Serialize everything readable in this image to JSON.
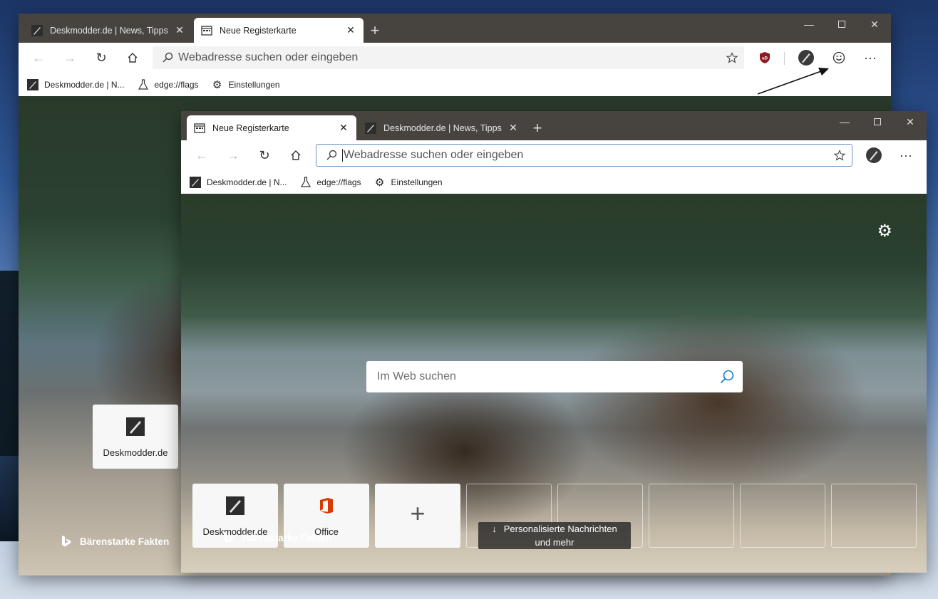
{
  "back_window": {
    "tabs": [
      {
        "label": "Deskmodder.de | News, Tipps und",
        "favicon": "deskmodder-icon",
        "close": "✕"
      },
      {
        "label": "Neue Registerkarte",
        "favicon": "newtab-icon",
        "close": "✕"
      }
    ],
    "new_tab": "+",
    "address_placeholder": "Webadresse suchen oder eingeben",
    "favorites": [
      {
        "label": "Deskmodder.de | N...",
        "icon": "deskmodder-icon"
      },
      {
        "label": "edge://flags",
        "icon": "flask-icon"
      },
      {
        "label": "Einstellungen",
        "icon": "gear-icon"
      }
    ],
    "tile": {
      "label": "Deskmodder.de"
    },
    "bing_label": "Bärenstarke Fakten"
  },
  "front_window": {
    "tabs": [
      {
        "label": "Neue Registerkarte",
        "favicon": "newtab-icon",
        "close": "✕"
      },
      {
        "label": "Deskmodder.de | News, Tipps und",
        "favicon": "deskmodder-icon",
        "close": "✕"
      }
    ],
    "new_tab": "+",
    "address_placeholder": "Webadresse suchen oder eingeben",
    "favorites": [
      {
        "label": "Deskmodder.de | N...",
        "icon": "deskmodder-icon"
      },
      {
        "label": "edge://flags",
        "icon": "flask-icon"
      },
      {
        "label": "Einstellungen",
        "icon": "gear-icon"
      }
    ],
    "search_placeholder": "Im Web suchen",
    "tiles": [
      {
        "label": "Deskmodder.de",
        "icon": "deskmodder-icon"
      },
      {
        "label": "Office",
        "icon": "office-icon"
      },
      {
        "label": "",
        "icon": "plus-icon"
      }
    ],
    "bing_label": "Bärenstarke Fakten",
    "news_button": {
      "line1": "Personalisierte Nachrichten",
      "line2": "und mehr"
    }
  },
  "colors": {
    "titlebar": "#474440",
    "ublock_red": "#8e1b1b",
    "office_orange": "#d83b01",
    "search_icon_blue": "#1c7cb8"
  }
}
